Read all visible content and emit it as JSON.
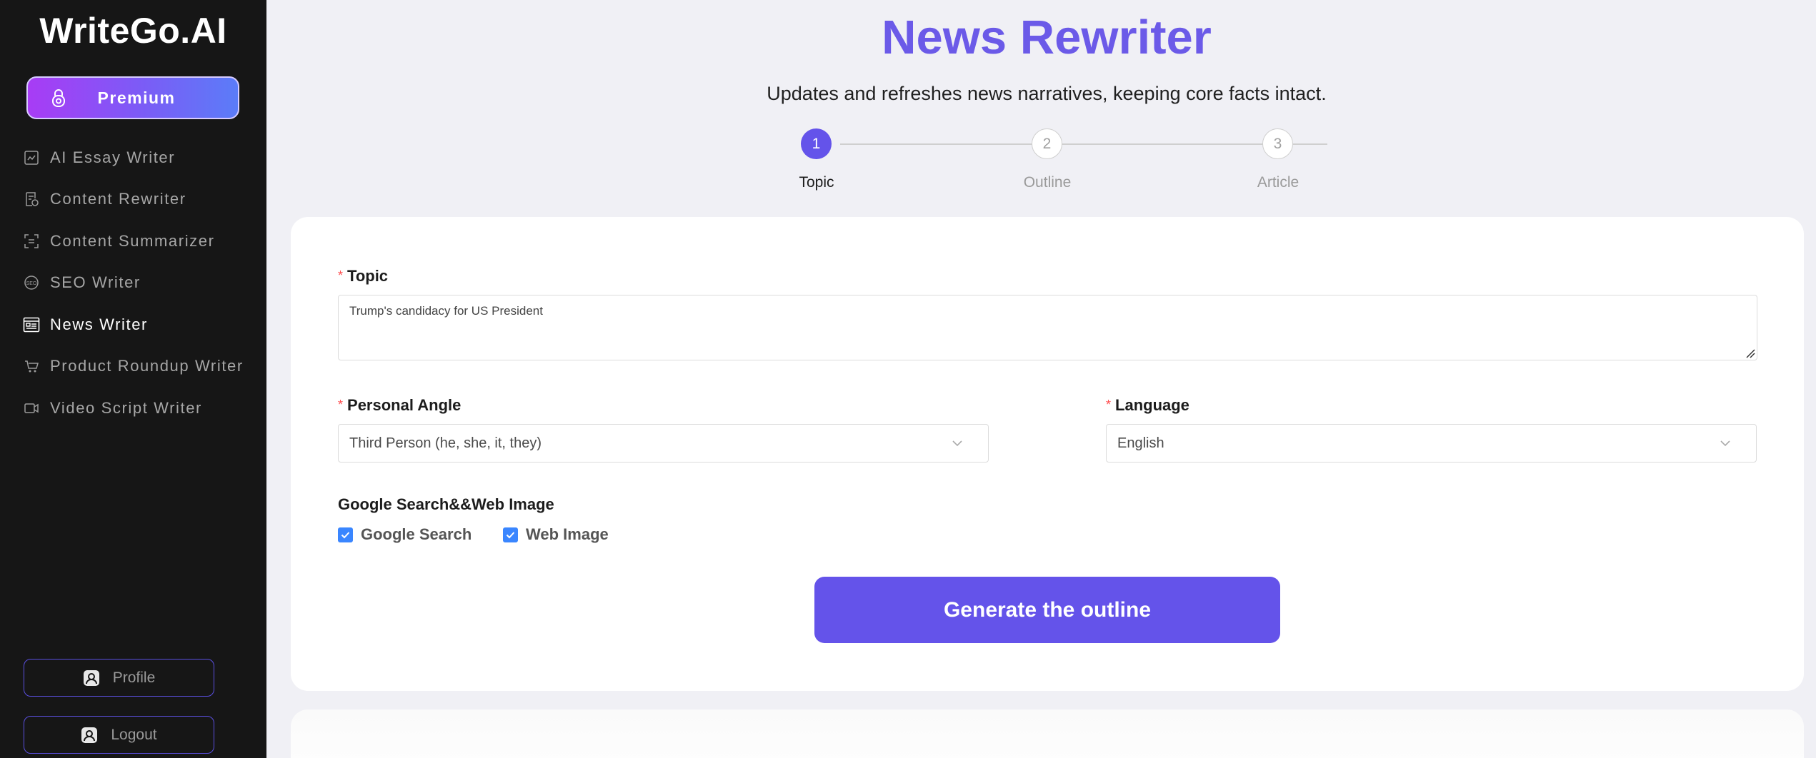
{
  "app": {
    "logo": "WriteGo.AI"
  },
  "sidebar": {
    "premium_label": "Premium",
    "items": [
      {
        "label": "AI Essay Writer",
        "icon": "essay-icon",
        "active": false
      },
      {
        "label": "Content Rewriter",
        "icon": "rewrite-icon",
        "active": false
      },
      {
        "label": "Content Summarizer",
        "icon": "summarize-icon",
        "active": false
      },
      {
        "label": "SEO Writer",
        "icon": "seo-icon",
        "active": false
      },
      {
        "label": "News Writer",
        "icon": "news-icon",
        "active": true
      },
      {
        "label": "Product Roundup Writer",
        "icon": "cart-icon",
        "active": false
      },
      {
        "label": "Video Script Writer",
        "icon": "video-icon",
        "active": false
      }
    ],
    "profile_label": "Profile",
    "logout_label": "Logout"
  },
  "header": {
    "title": "News Rewriter",
    "subtitle": "Updates and refreshes news narratives, keeping core facts intact."
  },
  "steps": [
    {
      "number": "1",
      "label": "Topic",
      "active": true
    },
    {
      "number": "2",
      "label": "Outline",
      "active": false
    },
    {
      "number": "3",
      "label": "Article",
      "active": false
    }
  ],
  "form": {
    "topic_label": "Topic",
    "topic_value": "Trump's candidacy for US President",
    "angle_label": "Personal Angle",
    "angle_value": "Third Person (he, she, it, they)",
    "language_label": "Language",
    "language_value": "English",
    "search_group_label": "Google Search&&Web Image",
    "google_search_label": "Google Search",
    "google_search_checked": true,
    "web_image_label": "Web Image",
    "web_image_checked": true,
    "required_mark": "*",
    "generate_label": "Generate the outline"
  },
  "colors": {
    "accent": "#6453ea",
    "sidebar_bg": "#161616",
    "checkbox": "#3a86ff",
    "required": "#ff4d4f"
  }
}
